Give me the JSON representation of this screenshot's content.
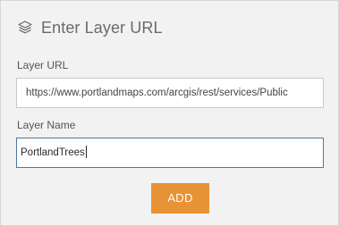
{
  "header": {
    "icon": "layers-icon",
    "title": "Enter Layer URL"
  },
  "form": {
    "url_label": "Layer URL",
    "url_value": "https://www.portlandmaps.com/arcgis/rest/services/Public",
    "name_label": "Layer Name",
    "name_value": "PortlandTrees"
  },
  "actions": {
    "add_label": "ADD"
  },
  "colors": {
    "panel_background": "#f2f2f2",
    "button_accent": "#e69235",
    "focused_border": "#52779a"
  }
}
